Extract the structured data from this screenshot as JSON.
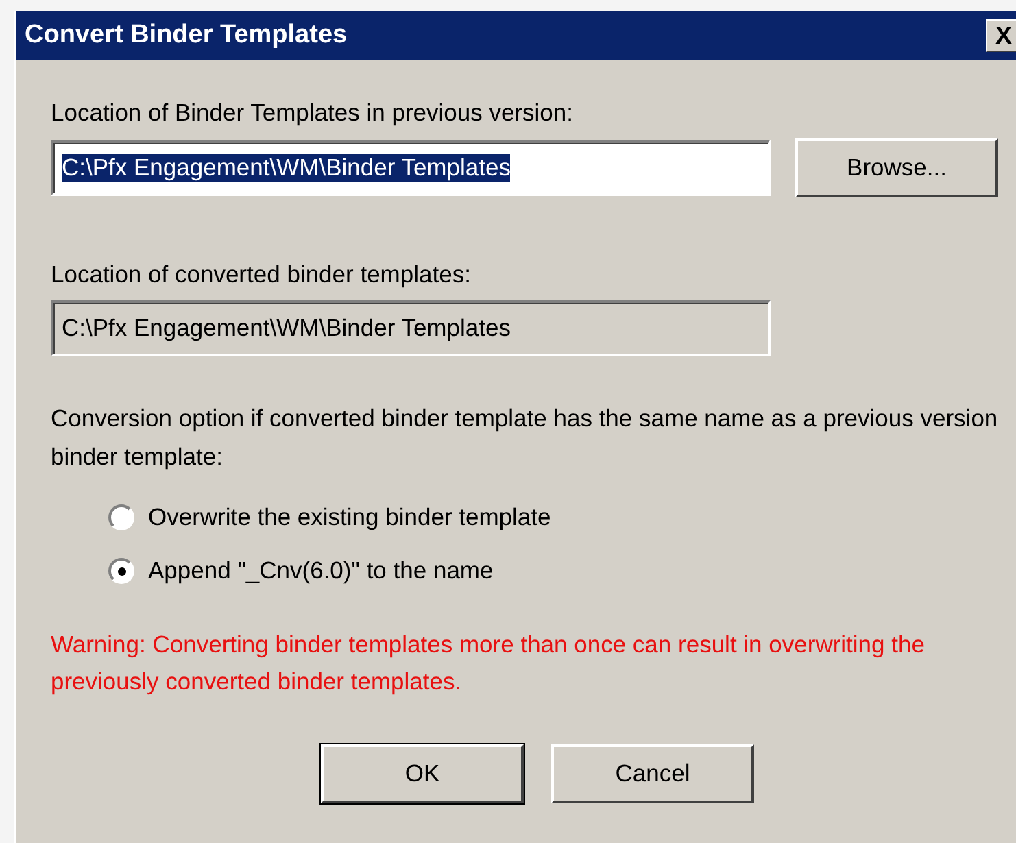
{
  "window": {
    "title": "Convert Binder Templates",
    "close": "X"
  },
  "source": {
    "label": "Location of Binder Templates in previous version:",
    "value": "C:\\Pfx Engagement\\WM\\Binder Templates",
    "text_selected": true,
    "disabled": false,
    "browse": "Browse..."
  },
  "target": {
    "label": "Location of converted binder templates:",
    "value": "C:\\Pfx Engagement\\WM\\Binder Templates",
    "disabled": true
  },
  "option_prompt": "Conversion option if converted binder template has the same name as a previous version binder template:",
  "options": [
    {
      "label": "Overwrite the existing binder template",
      "selected": false
    },
    {
      "label": "Append \"_Cnv(6.0)\" to the name",
      "selected": true
    }
  ],
  "warning": "Warning: Converting binder templates more than once can result in overwriting the previously converted binder templates.",
  "buttons": [
    {
      "label": "OK",
      "default": true
    },
    {
      "label": "Cancel",
      "default": false
    }
  ]
}
